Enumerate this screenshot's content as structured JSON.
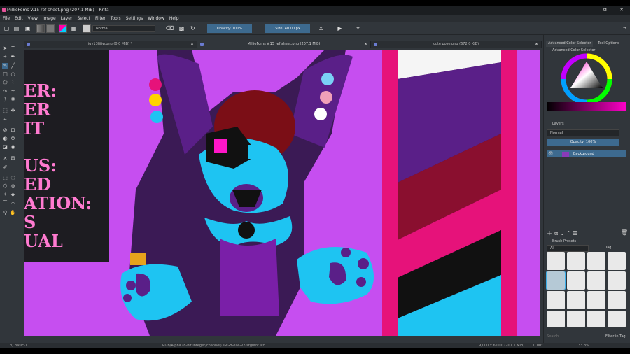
{
  "window": {
    "title": "MillieFoms V.15 ref sheet.png (207.1 MiB) – Krita",
    "controls": {
      "minimize": "–",
      "restore": "⧉",
      "close": "✕"
    }
  },
  "menu": [
    "File",
    "Edit",
    "View",
    "Image",
    "Layer",
    "Select",
    "Filter",
    "Tools",
    "Settings",
    "Window",
    "Help"
  ],
  "toolbar": {
    "blend_mode": "Normal",
    "opacity": "Opacity: 100%",
    "size": "Size: 40.00 px"
  },
  "tabs": [
    {
      "label": "igy13fjfjw.png (0.0 MiB) *",
      "close": "✕"
    },
    {
      "label": "MillieFoms V.15 ref sheet.png (207.1 MiB)",
      "close": "✕"
    },
    {
      "label": "cute pose.png (672.0 KiB)",
      "close": "✕"
    }
  ],
  "canvas": {
    "ref_sheet_lines": [
      "ER:",
      "ER",
      "IT",
      "US:",
      "ED",
      "ATION:",
      "S",
      "UAL"
    ]
  },
  "dock": {
    "tabs": [
      "Advanced Color Selector",
      "Tool Options"
    ],
    "color_selector_title": "Advanced Color Selector",
    "layers_title": "Layers",
    "layers_blend": "Normal",
    "layers_opacity": "Opacity: 100%",
    "layer_name": "Background",
    "brush_presets_title": "Brush Presets",
    "brush_filter": "All",
    "brush_tag": "Tag",
    "brush_search": "Search",
    "filter_in_tag": "Filter in Tag"
  },
  "status": {
    "brush": "b) Basic-1",
    "color_space": "RGB/Alpha (8-bit integer/channel)  sRGB-elle-V2-srgbtrc.icc",
    "dimensions": "9,000 x 6,000 (207.1 MiB)",
    "rotation": "0.00°",
    "zoom": "33.3%"
  },
  "colors": {
    "accent": "#3d6a8f",
    "canvas_magenta": "#c84cf0",
    "fur_cyan": "#1ec4f2",
    "fur_purple": "#5a1f88",
    "stripe_pink": "#e6127a"
  }
}
